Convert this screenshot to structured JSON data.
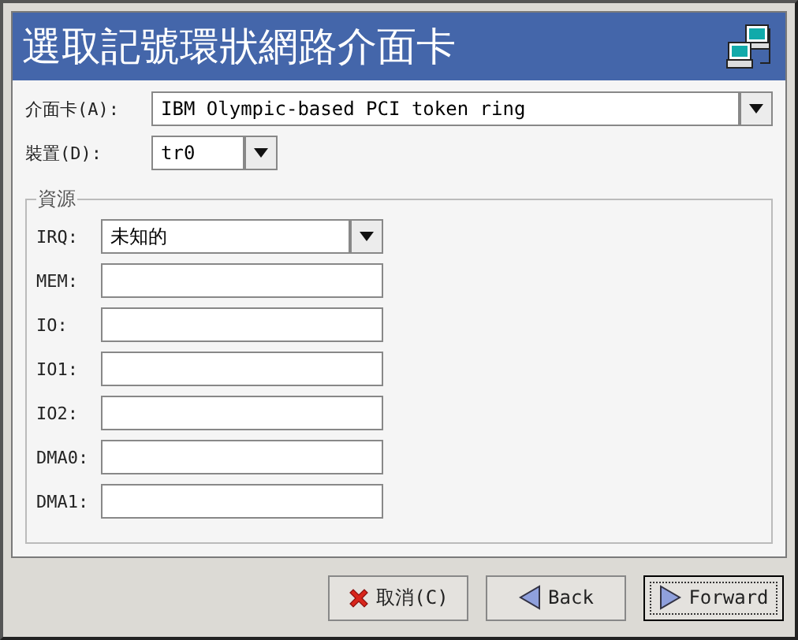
{
  "header": {
    "title": "選取記號環狀網路介面卡"
  },
  "adapter": {
    "label": "介面卡(A):",
    "value": "IBM Olympic-based PCI token ring"
  },
  "device": {
    "label": "裝置(D):",
    "value": "tr0"
  },
  "resources": {
    "title": "資源",
    "fields": [
      {
        "kind": "combo",
        "label": "IRQ:",
        "value": "未知的"
      },
      {
        "kind": "text",
        "label": "MEM:"
      },
      {
        "kind": "text",
        "label": "IO:"
      },
      {
        "kind": "text",
        "label": "IO1:"
      },
      {
        "kind": "text",
        "label": "IO2:"
      },
      {
        "kind": "text",
        "label": "DMA0:"
      },
      {
        "kind": "text",
        "label": "DMA1:"
      }
    ]
  },
  "buttons": [
    {
      "kind": "cancel",
      "label": "取消(C)",
      "focused": false
    },
    {
      "kind": "back",
      "label": "Back",
      "focused": false
    },
    {
      "kind": "forward",
      "label": "Forward",
      "focused": true
    }
  ]
}
